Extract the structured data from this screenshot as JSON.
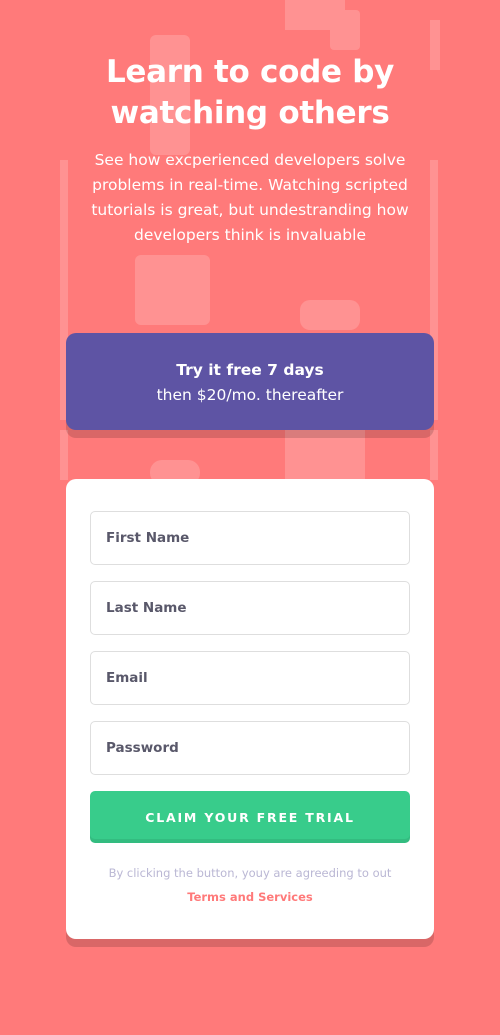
{
  "intro": {
    "heading": "Learn to code by watching others",
    "description": "See how excperienced developers solve problems in real-time. Watching scripted tutorials is great, but undestranding how developers think is invaluable"
  },
  "promo": {
    "bold_text": "Try it free 7 days",
    "rest_text": "then $20/mo. thereafter"
  },
  "form": {
    "first_name_placeholder": "First Name",
    "last_name_placeholder": "Last Name",
    "email_placeholder": "Email",
    "password_placeholder": "Password",
    "submit_label": "CLAIM YOUR FREE TRIAL",
    "terms_prefix": "By clicking the button, youy are agreeding to out",
    "terms_link": "Terms and Services"
  },
  "colors": {
    "background": "#ff7a7a",
    "promo": "#5e54a4",
    "submit": "#38cc8b",
    "link": "#ff7a7a"
  }
}
